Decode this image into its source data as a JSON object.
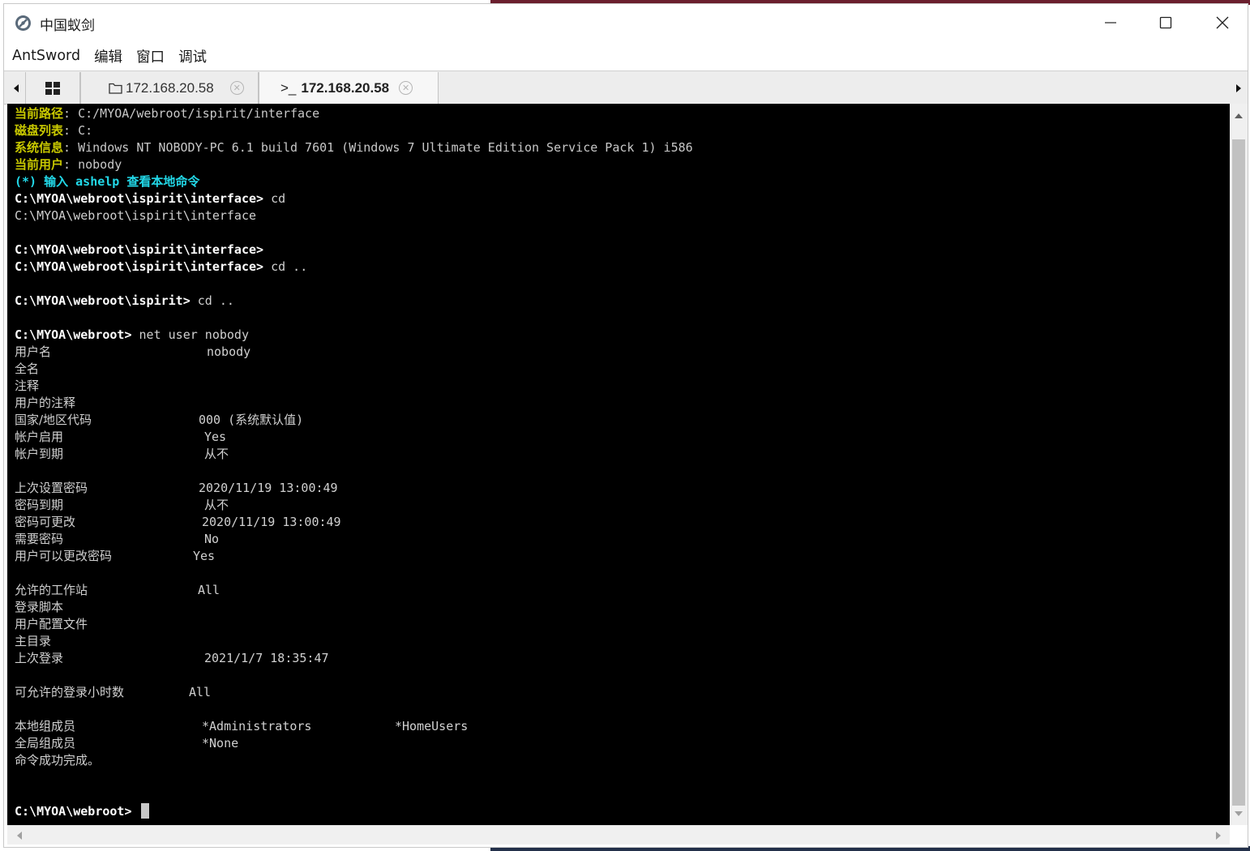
{
  "window": {
    "title": "中国蚁剑",
    "icons": {
      "app": "antsword-logo-icon",
      "minimize": "minimize-icon",
      "maximize": "maximize-icon",
      "close": "close-icon"
    }
  },
  "menu": [
    "AntSword",
    "编辑",
    "窗口",
    "调试"
  ],
  "tabs": [
    {
      "icon": "grid-icon",
      "label": ""
    },
    {
      "icon": "folder-icon",
      "label": "172.168.20.58"
    },
    {
      "icon": "terminal-icon",
      "label": "172.168.20.58",
      "prefix": ">_"
    }
  ],
  "terminal": {
    "header": [
      {
        "label": "当前路径",
        "value": "C:/MYOA/webroot/ispirit/interface"
      },
      {
        "label": "磁盘列表",
        "value": "C:"
      },
      {
        "label": "系统信息",
        "value": "Windows NT NOBODY-PC 6.1 build 7601 (Windows 7 Ultimate Edition Service Pack 1) i586"
      },
      {
        "label": "当前用户",
        "value": "nobody"
      }
    ],
    "help": "(*) 输入 ashelp 查看本地命令",
    "history": [
      {
        "prompt": "C:\\MYOA\\webroot\\ispirit\\interface>",
        "cmd": "cd"
      },
      {
        "output": "C:\\MYOA\\webroot\\ispirit\\interface"
      },
      {
        "blank": true
      },
      {
        "prompt": "C:\\MYOA\\webroot\\ispirit\\interface>",
        "cmd": ""
      },
      {
        "prompt": "C:\\MYOA\\webroot\\ispirit\\interface>",
        "cmd": "cd .."
      },
      {
        "blank": true
      },
      {
        "prompt": "C:\\MYOA\\webroot\\ispirit>",
        "cmd": "cd .."
      },
      {
        "blank": true
      },
      {
        "prompt": "C:\\MYOA\\webroot>",
        "cmd": "net user nobody"
      }
    ],
    "user_info": [
      {
        "key": "用户名",
        "val": "nobody"
      },
      {
        "key": "全名",
        "val": ""
      },
      {
        "key": "注释",
        "val": ""
      },
      {
        "key": "用户的注释",
        "val": ""
      },
      {
        "key": "国家/地区代码",
        "val": "000 (系统默认值)"
      },
      {
        "key": "帐户启用",
        "val": "Yes"
      },
      {
        "key": "帐户到期",
        "val": "从不"
      },
      {
        "blank": true
      },
      {
        "key": "上次设置密码",
        "val": "2020/11/19 13:00:49"
      },
      {
        "key": "密码到期",
        "val": "从不"
      },
      {
        "key": "密码可更改",
        "val": "2020/11/19 13:00:49"
      },
      {
        "key": "需要密码",
        "val": "No"
      },
      {
        "key": "用户可以更改密码",
        "val": "Yes"
      },
      {
        "blank": true
      },
      {
        "key": "允许的工作站",
        "val": "All"
      },
      {
        "key": "登录脚本",
        "val": ""
      },
      {
        "key": "用户配置文件",
        "val": ""
      },
      {
        "key": "主目录",
        "val": ""
      },
      {
        "key": "上次登录",
        "val": "2021/1/7 18:35:47"
      },
      {
        "blank": true
      },
      {
        "key": "可允许的登录小时数",
        "val": "All"
      },
      {
        "blank": true
      },
      {
        "key": "本地组成员",
        "val": "*Administrators",
        "val2": "*HomeUsers"
      },
      {
        "key": "全局组成员",
        "val": "*None"
      },
      {
        "key": "命令成功完成。",
        "val": ""
      }
    ],
    "final_prompt": "C:\\MYOA\\webroot>"
  },
  "colors": {
    "terminal_bg": "#000000",
    "label_yellow": "#c8c800",
    "help_cyan": "#22d8e8",
    "text": "#d0d0d0"
  }
}
